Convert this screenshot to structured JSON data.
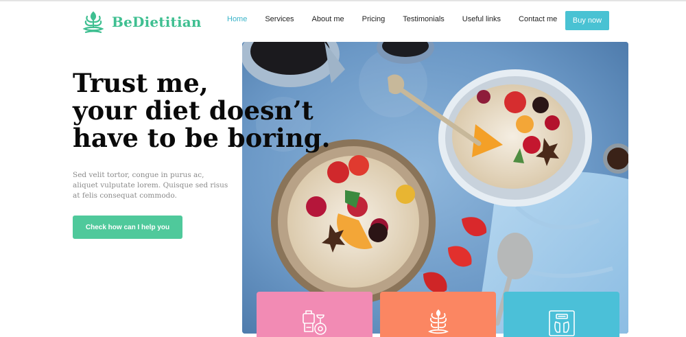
{
  "brand": {
    "name": "BeDietitian",
    "accent": "#3fbf91"
  },
  "nav": {
    "items": [
      {
        "label": "Home",
        "active": true
      },
      {
        "label": "Services",
        "active": false
      },
      {
        "label": "About me",
        "active": false
      },
      {
        "label": "Pricing",
        "active": false
      },
      {
        "label": "Testimonials",
        "active": false
      },
      {
        "label": "Useful links",
        "active": false
      },
      {
        "label": "Contact me",
        "active": false
      }
    ],
    "active_color": "#39b3c8"
  },
  "header": {
    "buy_label": "Buy now",
    "buy_color": "#49c2d3"
  },
  "hero": {
    "headline": [
      "Trust me,",
      "your diet doesn’t",
      "have to be boring."
    ],
    "subtext": "Sed velit tortor, congue in purus ac, aliquet vulputate lorem. Quisque sed risus at felis consequat commodo.",
    "cta_label": "Check how can I help you",
    "cta_color": "#4fc99b",
    "image": "breakfast-bowls-photo"
  },
  "cards": [
    {
      "icon": "kitchen-scale-icon",
      "color": "#f28bb4"
    },
    {
      "icon": "plant-icon",
      "color": "#fb8662"
    },
    {
      "icon": "body-scale-icon",
      "color": "#4bc0d8"
    }
  ]
}
